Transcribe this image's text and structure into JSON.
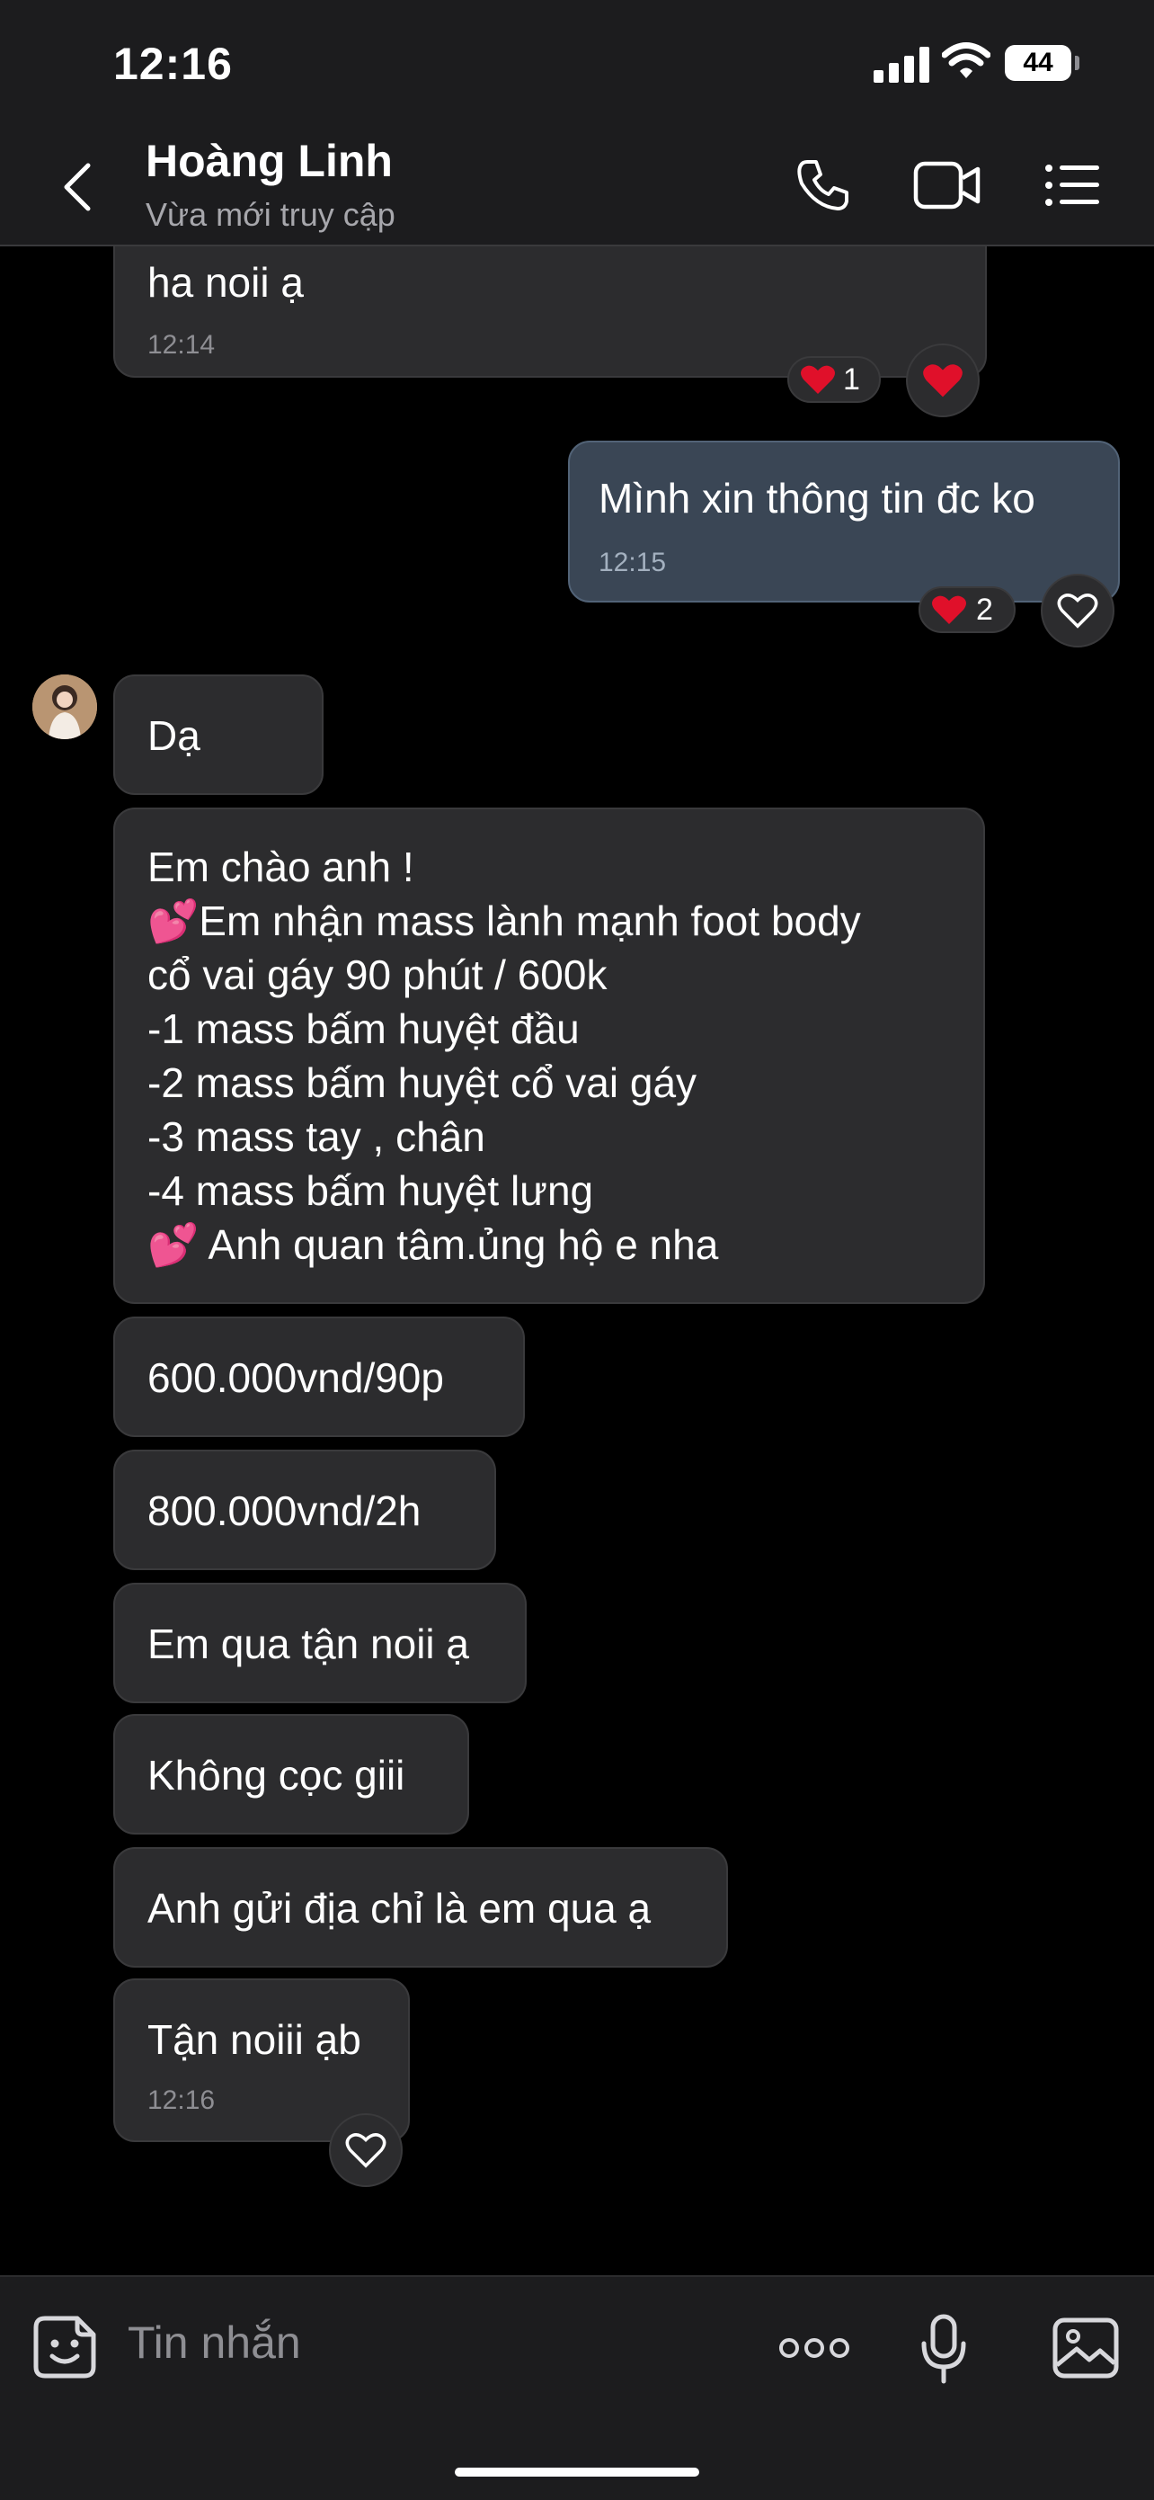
{
  "status_bar": {
    "time": "12:16",
    "battery": "44"
  },
  "header": {
    "contact_name": "Hoàng Linh",
    "status": "Vừa mới truy cập",
    "icons": [
      "back-icon",
      "phone-icon",
      "video-icon",
      "menu-icon"
    ]
  },
  "messages": [
    {
      "side": "in",
      "text": "ha noii ạ",
      "time": "12:14",
      "reaction_count": "1"
    },
    {
      "side": "out",
      "text": "Mình xin thông tin đc ko",
      "time": "12:15",
      "reaction_count": "2"
    },
    {
      "side": "in",
      "text": "Dạ"
    },
    {
      "side": "in",
      "lines": [
        "Em chào anh !",
        "💕Em nhận mass lành mạnh foot body",
        "cổ vai gáy 90 phút / 600k",
        "-1 mass bấm huyệt đầu",
        "-2 mass bấm huyệt cổ vai gáy",
        "-3 mass tay , chân",
        "-4 mass bấm huyệt lưng",
        "💕  Anh quan tâm.ủng hộ e nha"
      ]
    },
    {
      "side": "in",
      "text": "600.000vnd/90p"
    },
    {
      "side": "in",
      "text": "800.000vnd/2h"
    },
    {
      "side": "in",
      "text": "Em qua tận noii ạ"
    },
    {
      "side": "in",
      "text": "Không cọc giii"
    },
    {
      "side": "in",
      "text": "Anh gửi địa chỉ là em qua ạ"
    },
    {
      "side": "in",
      "text": "Tận noiii ạb",
      "time": "12:16"
    }
  ],
  "input_bar": {
    "placeholder": "Tin nhắn",
    "icons": [
      "sticker-icon",
      "more-icon",
      "microphone-icon",
      "image-icon"
    ]
  },
  "colors": {
    "background": "#000000",
    "bar": "#1c1c1e",
    "incoming_bubble": "#2c2c2e",
    "outgoing_bubble": "#3a4655",
    "heart": "#e0102a"
  }
}
